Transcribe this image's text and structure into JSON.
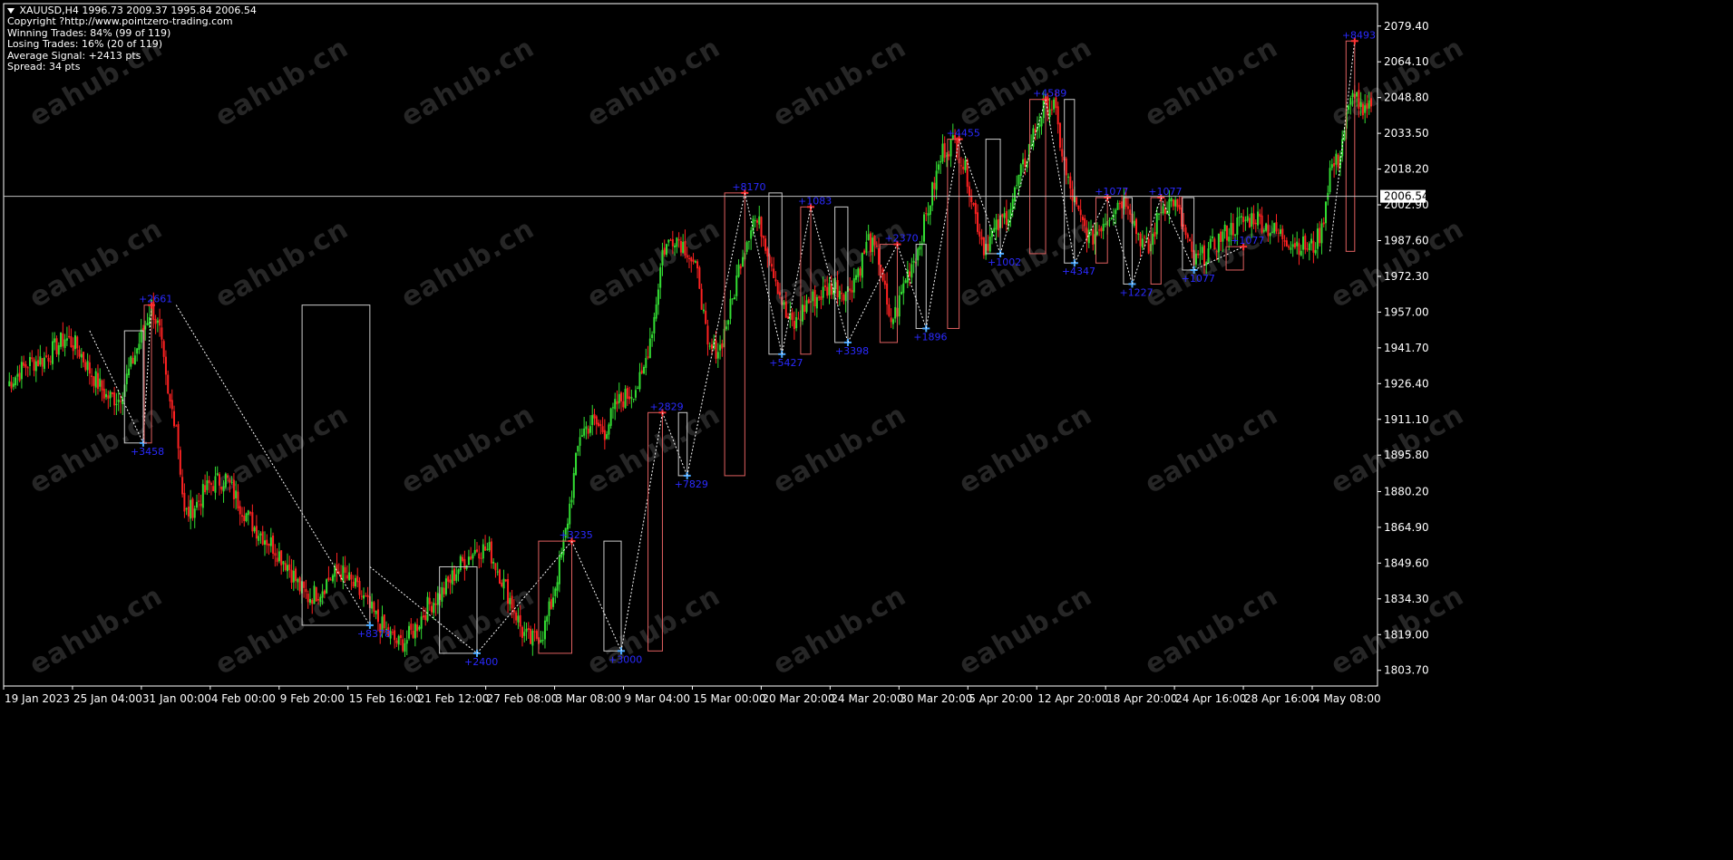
{
  "window": {
    "symbol_line": "XAUUSD,H4  1996.73 2009.37 1995.84 2006.54",
    "copyright": "Copyright ?http://www.pointzero-trading.com",
    "winning": "Winning Trades: 84% (99 of 119)",
    "losing": "Losing Trades: 16% (20 of 119)",
    "average": "Average Signal: +2413 pts",
    "spread": "Spread: 34 pts"
  },
  "colors": {
    "background": "#000000",
    "bull": "#33dd33",
    "bear": "#ff2222",
    "grid_text": "#ffffff",
    "trade_label": "#2a2aff",
    "buy_arrow": "#4aa8ff",
    "sell_arrow": "#ff3333",
    "watermark": "#262626"
  },
  "watermark_text": "eahub.cn",
  "chart_data": {
    "type": "candlestick",
    "symbol": "XAUUSD",
    "timeframe": "H4",
    "current_price": "2006.54",
    "ylim": [
      1797.0,
      2089.0
    ],
    "price_ticks": [
      "2079.40",
      "2064.10",
      "2048.80",
      "2033.50",
      "2018.20",
      "2002.90",
      "1987.60",
      "1972.30",
      "1957.00",
      "1941.70",
      "1926.40",
      "1911.10",
      "1895.80",
      "1880.20",
      "1864.90",
      "1849.60",
      "1834.30",
      "1819.00",
      "1803.70"
    ],
    "time_ticks": [
      "19 Jan 2023",
      "25 Jan 04:00",
      "31 Jan 00:00",
      "4 Feb 00:00",
      "9 Feb 20:00",
      "15 Feb 16:00",
      "21 Feb 12:00",
      "27 Feb 08:00",
      "3 Mar 08:00",
      "9 Mar 04:00",
      "15 Mar 00:00",
      "20 Mar 20:00",
      "24 Mar 20:00",
      "30 Mar 20:00",
      "5 Apr 20:00",
      "12 Apr 20:00",
      "18 Apr 20:00",
      "24 Apr 16:00",
      "28 Apr 16:00",
      "4 May 08:00"
    ],
    "anchors": [
      [
        0,
        1926
      ],
      [
        10,
        1935
      ],
      [
        18,
        1937
      ],
      [
        28,
        1946
      ],
      [
        34,
        1942
      ],
      [
        40,
        1932
      ],
      [
        48,
        1921
      ],
      [
        54,
        1920
      ],
      [
        58,
        1929
      ],
      [
        66,
        1949
      ],
      [
        70,
        1960
      ],
      [
        74,
        1948
      ],
      [
        78,
        1920
      ],
      [
        82,
        1910
      ],
      [
        86,
        1870
      ],
      [
        92,
        1875
      ],
      [
        98,
        1883
      ],
      [
        106,
        1886
      ],
      [
        112,
        1876
      ],
      [
        120,
        1865
      ],
      [
        128,
        1858
      ],
      [
        136,
        1849
      ],
      [
        142,
        1839
      ],
      [
        146,
        1835
      ],
      [
        152,
        1838
      ],
      [
        156,
        1843
      ],
      [
        162,
        1846
      ],
      [
        170,
        1838
      ],
      [
        176,
        1830
      ],
      [
        184,
        1820
      ],
      [
        190,
        1815
      ],
      [
        194,
        1817
      ],
      [
        198,
        1822
      ],
      [
        204,
        1831
      ],
      [
        212,
        1838
      ],
      [
        220,
        1849
      ],
      [
        228,
        1856
      ],
      [
        234,
        1855
      ],
      [
        240,
        1843
      ],
      [
        246,
        1830
      ],
      [
        250,
        1820
      ],
      [
        254,
        1816
      ],
      [
        260,
        1820
      ],
      [
        264,
        1832
      ],
      [
        270,
        1857
      ],
      [
        274,
        1880
      ],
      [
        278,
        1905
      ],
      [
        284,
        1910
      ],
      [
        290,
        1906
      ],
      [
        296,
        1918
      ],
      [
        302,
        1922
      ],
      [
        308,
        1928
      ],
      [
        314,
        1955
      ],
      [
        318,
        1983
      ],
      [
        324,
        1990
      ],
      [
        330,
        1984
      ],
      [
        336,
        1970
      ],
      [
        340,
        1940
      ],
      [
        346,
        1942
      ],
      [
        352,
        1962
      ],
      [
        356,
        1980
      ],
      [
        362,
        1997
      ],
      [
        366,
        1993
      ],
      [
        372,
        1975
      ],
      [
        378,
        1955
      ],
      [
        382,
        1951
      ],
      [
        388,
        1961
      ],
      [
        394,
        1964
      ],
      [
        400,
        1968
      ],
      [
        408,
        1966
      ],
      [
        414,
        1977
      ],
      [
        418,
        1988
      ],
      [
        424,
        1978
      ],
      [
        428,
        1952
      ],
      [
        432,
        1958
      ],
      [
        436,
        1972
      ],
      [
        442,
        1984
      ],
      [
        446,
        1998
      ],
      [
        450,
        2012
      ],
      [
        454,
        2026
      ],
      [
        460,
        2030
      ],
      [
        466,
        2015
      ],
      [
        470,
        1998
      ],
      [
        474,
        1985
      ],
      [
        478,
        1990
      ],
      [
        486,
        2000
      ],
      [
        492,
        2016
      ],
      [
        498,
        2033
      ],
      [
        504,
        2046
      ],
      [
        508,
        2045
      ],
      [
        514,
        2015
      ],
      [
        520,
        1998
      ],
      [
        526,
        1988
      ],
      [
        532,
        1996
      ],
      [
        540,
        2005
      ],
      [
        544,
        2005
      ],
      [
        548,
        1992
      ],
      [
        554,
        1983
      ],
      [
        560,
        2002
      ],
      [
        566,
        2005
      ],
      [
        570,
        1995
      ],
      [
        576,
        1978
      ],
      [
        582,
        1982
      ],
      [
        590,
        1990
      ],
      [
        598,
        1995
      ],
      [
        606,
        1998
      ],
      [
        612,
        1993
      ],
      [
        618,
        1990
      ],
      [
        624,
        1987
      ],
      [
        630,
        1985
      ],
      [
        634,
        1985
      ],
      [
        638,
        1992
      ],
      [
        642,
        2018
      ],
      [
        646,
        2022
      ],
      [
        650,
        2040
      ],
      [
        654,
        2052
      ],
      [
        658,
        2040
      ],
      [
        662,
        2045
      ]
    ],
    "trades": [
      {
        "type": "sell",
        "label": "+3458",
        "from": [
          40,
          1949
        ],
        "to": [
          66,
          1901
        ]
      },
      {
        "type": "buy",
        "label": "+2661",
        "from": [
          66,
          1901
        ],
        "to": [
          70,
          1960
        ]
      },
      {
        "type": "sell",
        "label": "+8378",
        "from": [
          82,
          1960
        ],
        "to": [
          176,
          1823
        ]
      },
      {
        "type": "sell",
        "label": "+2400",
        "from": [
          176,
          1848
        ],
        "to": [
          228,
          1811
        ]
      },
      {
        "type": "buy",
        "label": "+3235",
        "from": [
          228,
          1811
        ],
        "to": [
          274,
          1859
        ]
      },
      {
        "type": "sell",
        "label": "+3000",
        "from": [
          274,
          1859
        ],
        "to": [
          298,
          1812
        ]
      },
      {
        "type": "buy",
        "label": "+2829",
        "from": [
          298,
          1812
        ],
        "to": [
          318,
          1914
        ]
      },
      {
        "type": "sell",
        "label": "+7829",
        "from": [
          318,
          1914
        ],
        "to": [
          330,
          1887
        ]
      },
      {
        "type": "buy",
        "label": "+8170",
        "from": [
          330,
          1887
        ],
        "to": [
          358,
          2008
        ]
      },
      {
        "type": "sell",
        "label": "+5427",
        "from": [
          358,
          2008
        ],
        "to": [
          376,
          1939
        ]
      },
      {
        "type": "buy",
        "label": "+1083",
        "from": [
          376,
          1939
        ],
        "to": [
          390,
          2002
        ]
      },
      {
        "type": "sell",
        "label": "+3398",
        "from": [
          390,
          2002
        ],
        "to": [
          408,
          1944
        ]
      },
      {
        "type": "buy",
        "label": "+2370",
        "from": [
          408,
          1944
        ],
        "to": [
          432,
          1986
        ]
      },
      {
        "type": "sell",
        "label": "+1896",
        "from": [
          432,
          1986
        ],
        "to": [
          446,
          1950
        ]
      },
      {
        "type": "buy",
        "label": "+4455",
        "from": [
          446,
          1950
        ],
        "to": [
          462,
          2031
        ]
      },
      {
        "type": "sell",
        "label": "+1002",
        "from": [
          462,
          2031
        ],
        "to": [
          482,
          1982
        ]
      },
      {
        "type": "buy",
        "label": "+4589",
        "from": [
          482,
          1982
        ],
        "to": [
          504,
          2048
        ]
      },
      {
        "type": "sell",
        "label": "+4347",
        "from": [
          504,
          2048
        ],
        "to": [
          518,
          1978
        ]
      },
      {
        "type": "buy",
        "label": "+1077",
        "from": [
          518,
          1978
        ],
        "to": [
          534,
          2006
        ]
      },
      {
        "type": "sell",
        "label": "+1227",
        "from": [
          534,
          2006
        ],
        "to": [
          546,
          1969
        ]
      },
      {
        "type": "buy",
        "label": "+1077",
        "from": [
          546,
          1969
        ],
        "to": [
          560,
          2006
        ]
      },
      {
        "type": "sell",
        "label": "+1077",
        "from": [
          560,
          2006
        ],
        "to": [
          576,
          1975
        ]
      },
      {
        "type": "buy",
        "label": "+1077",
        "from": [
          576,
          1975
        ],
        "to": [
          600,
          1985
        ]
      },
      {
        "type": "buy",
        "label": "+8493",
        "from": [
          642,
          1983
        ],
        "to": [
          654,
          2073
        ]
      }
    ]
  }
}
